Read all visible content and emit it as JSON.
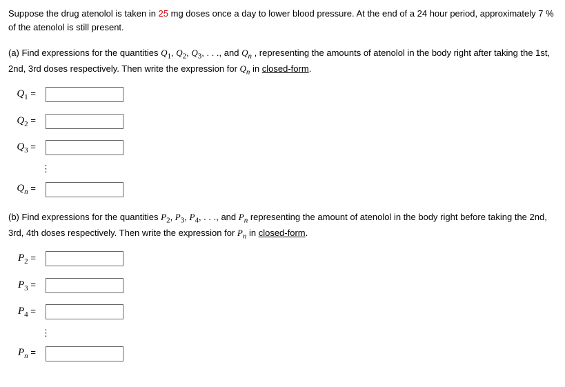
{
  "intro": {
    "t1": "Suppose the drug atenolol is taken in ",
    "dose": "25",
    "t2": " mg doses once a day to lower blood pressure. At the end of a 24 hour period, approximately 7 % of the atenolol is still present."
  },
  "part_a": {
    "prefix": "(a) Find expressions for the quantities ",
    "q1": "Q",
    "s1": "1",
    "comma": ", ",
    "q2": "Q",
    "s2": "2",
    "q3": "Q",
    "s3": "3",
    "ellips": ", . . ., and ",
    "qn": "Q",
    "sn": "n",
    "mid": " , representing the amounts of atenolol in the body right after taking the 1st, 2nd, 3rd doses respectively. Then write the expression for  ",
    "qn2": "Q",
    "sn2": "n",
    "tail": "  in ",
    "closed": "closed-form",
    "dot": "."
  },
  "part_b": {
    "prefix": "(b) Find expressions for the quantities ",
    "p2": "P",
    "s2": "2",
    "comma": ", ",
    "p3": "P",
    "s3": "3",
    "p4": "P",
    "s4": "4",
    "ellips": ", . . ., and ",
    "pn": "P",
    "sn": "n",
    "mid": "  representing the amount of atenolol in the body right before taking the 2nd, 3rd, 4th doses respectively. Then write the expression for  ",
    "pn2": "P",
    "sn2": "n",
    "tail": "  in ",
    "closed": "closed-form",
    "dot": "."
  },
  "labels": {
    "Q": "Q",
    "P": "P",
    "eq": "=",
    "s1": "1",
    "s2": "2",
    "s3": "3",
    "s4": "4",
    "sn": "n"
  },
  "vdots": "⋮"
}
